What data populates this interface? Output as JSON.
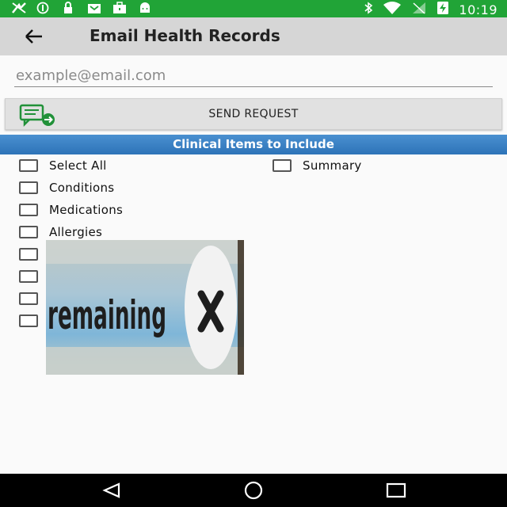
{
  "status_bar": {
    "time": "10:19",
    "icons": [
      "sync-off-icon",
      "alert-circle-icon",
      "lock-icon",
      "inbox-icon",
      "briefcase-icon",
      "android-icon",
      "bluetooth-icon",
      "wifi-icon",
      "no-signal-icon",
      "battery-charging-icon"
    ],
    "bg_color": "#21a437"
  },
  "app_bar": {
    "title": "Email Health Records",
    "back_icon": "arrow-back-icon"
  },
  "email": {
    "placeholder": "example@email.com",
    "value": ""
  },
  "send_button": {
    "label": "SEND REQUEST",
    "icon": "send-message-icon"
  },
  "section": {
    "title": "Clinical Items to Include"
  },
  "checkboxes": {
    "left": [
      {
        "label": "Select All",
        "checked": false
      },
      {
        "label": "Conditions",
        "checked": false
      },
      {
        "label": "Medications",
        "checked": false
      },
      {
        "label": "Allergies",
        "checked": false
      },
      {
        "label": "",
        "checked": false
      },
      {
        "label": "",
        "checked": false
      },
      {
        "label": "",
        "checked": false
      },
      {
        "label": "",
        "checked": false
      }
    ],
    "right": [
      {
        "label": "Summary",
        "checked": false
      }
    ]
  },
  "ad": {
    "text": "remaining",
    "icon": "close-x-icon"
  },
  "nav_bar": {
    "icons": [
      "back-triangle-icon",
      "home-circle-icon",
      "recents-square-icon"
    ]
  }
}
